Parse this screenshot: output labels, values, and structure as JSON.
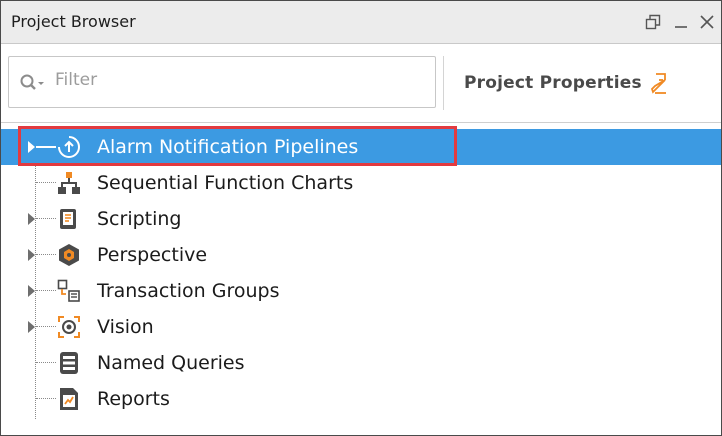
{
  "window": {
    "title": "Project Browser",
    "restore_icon": "restore-icon",
    "minimize_icon": "minimize-icon",
    "close_icon": "close-icon"
  },
  "toolbar": {
    "filter_placeholder": "Filter",
    "project_properties_label": "Project Properties"
  },
  "tree": {
    "items": [
      {
        "label": "Alarm Notification Pipelines",
        "icon": "alarm-pipeline-icon",
        "expandable": true,
        "selected": true
      },
      {
        "label": "Sequential Function Charts",
        "icon": "sfc-icon",
        "expandable": false,
        "selected": false
      },
      {
        "label": "Scripting",
        "icon": "scripting-icon",
        "expandable": true,
        "selected": false
      },
      {
        "label": "Perspective",
        "icon": "perspective-icon",
        "expandable": true,
        "selected": false
      },
      {
        "label": "Transaction Groups",
        "icon": "transaction-groups-icon",
        "expandable": true,
        "selected": false
      },
      {
        "label": "Vision",
        "icon": "vision-icon",
        "expandable": true,
        "selected": false
      },
      {
        "label": "Named Queries",
        "icon": "named-queries-icon",
        "expandable": false,
        "selected": false
      },
      {
        "label": "Reports",
        "icon": "reports-icon",
        "expandable": false,
        "selected": false
      }
    ]
  },
  "colors": {
    "selection": "#3c9ae2",
    "highlight_border": "#e23a3f",
    "accent_orange": "#f08a24"
  }
}
